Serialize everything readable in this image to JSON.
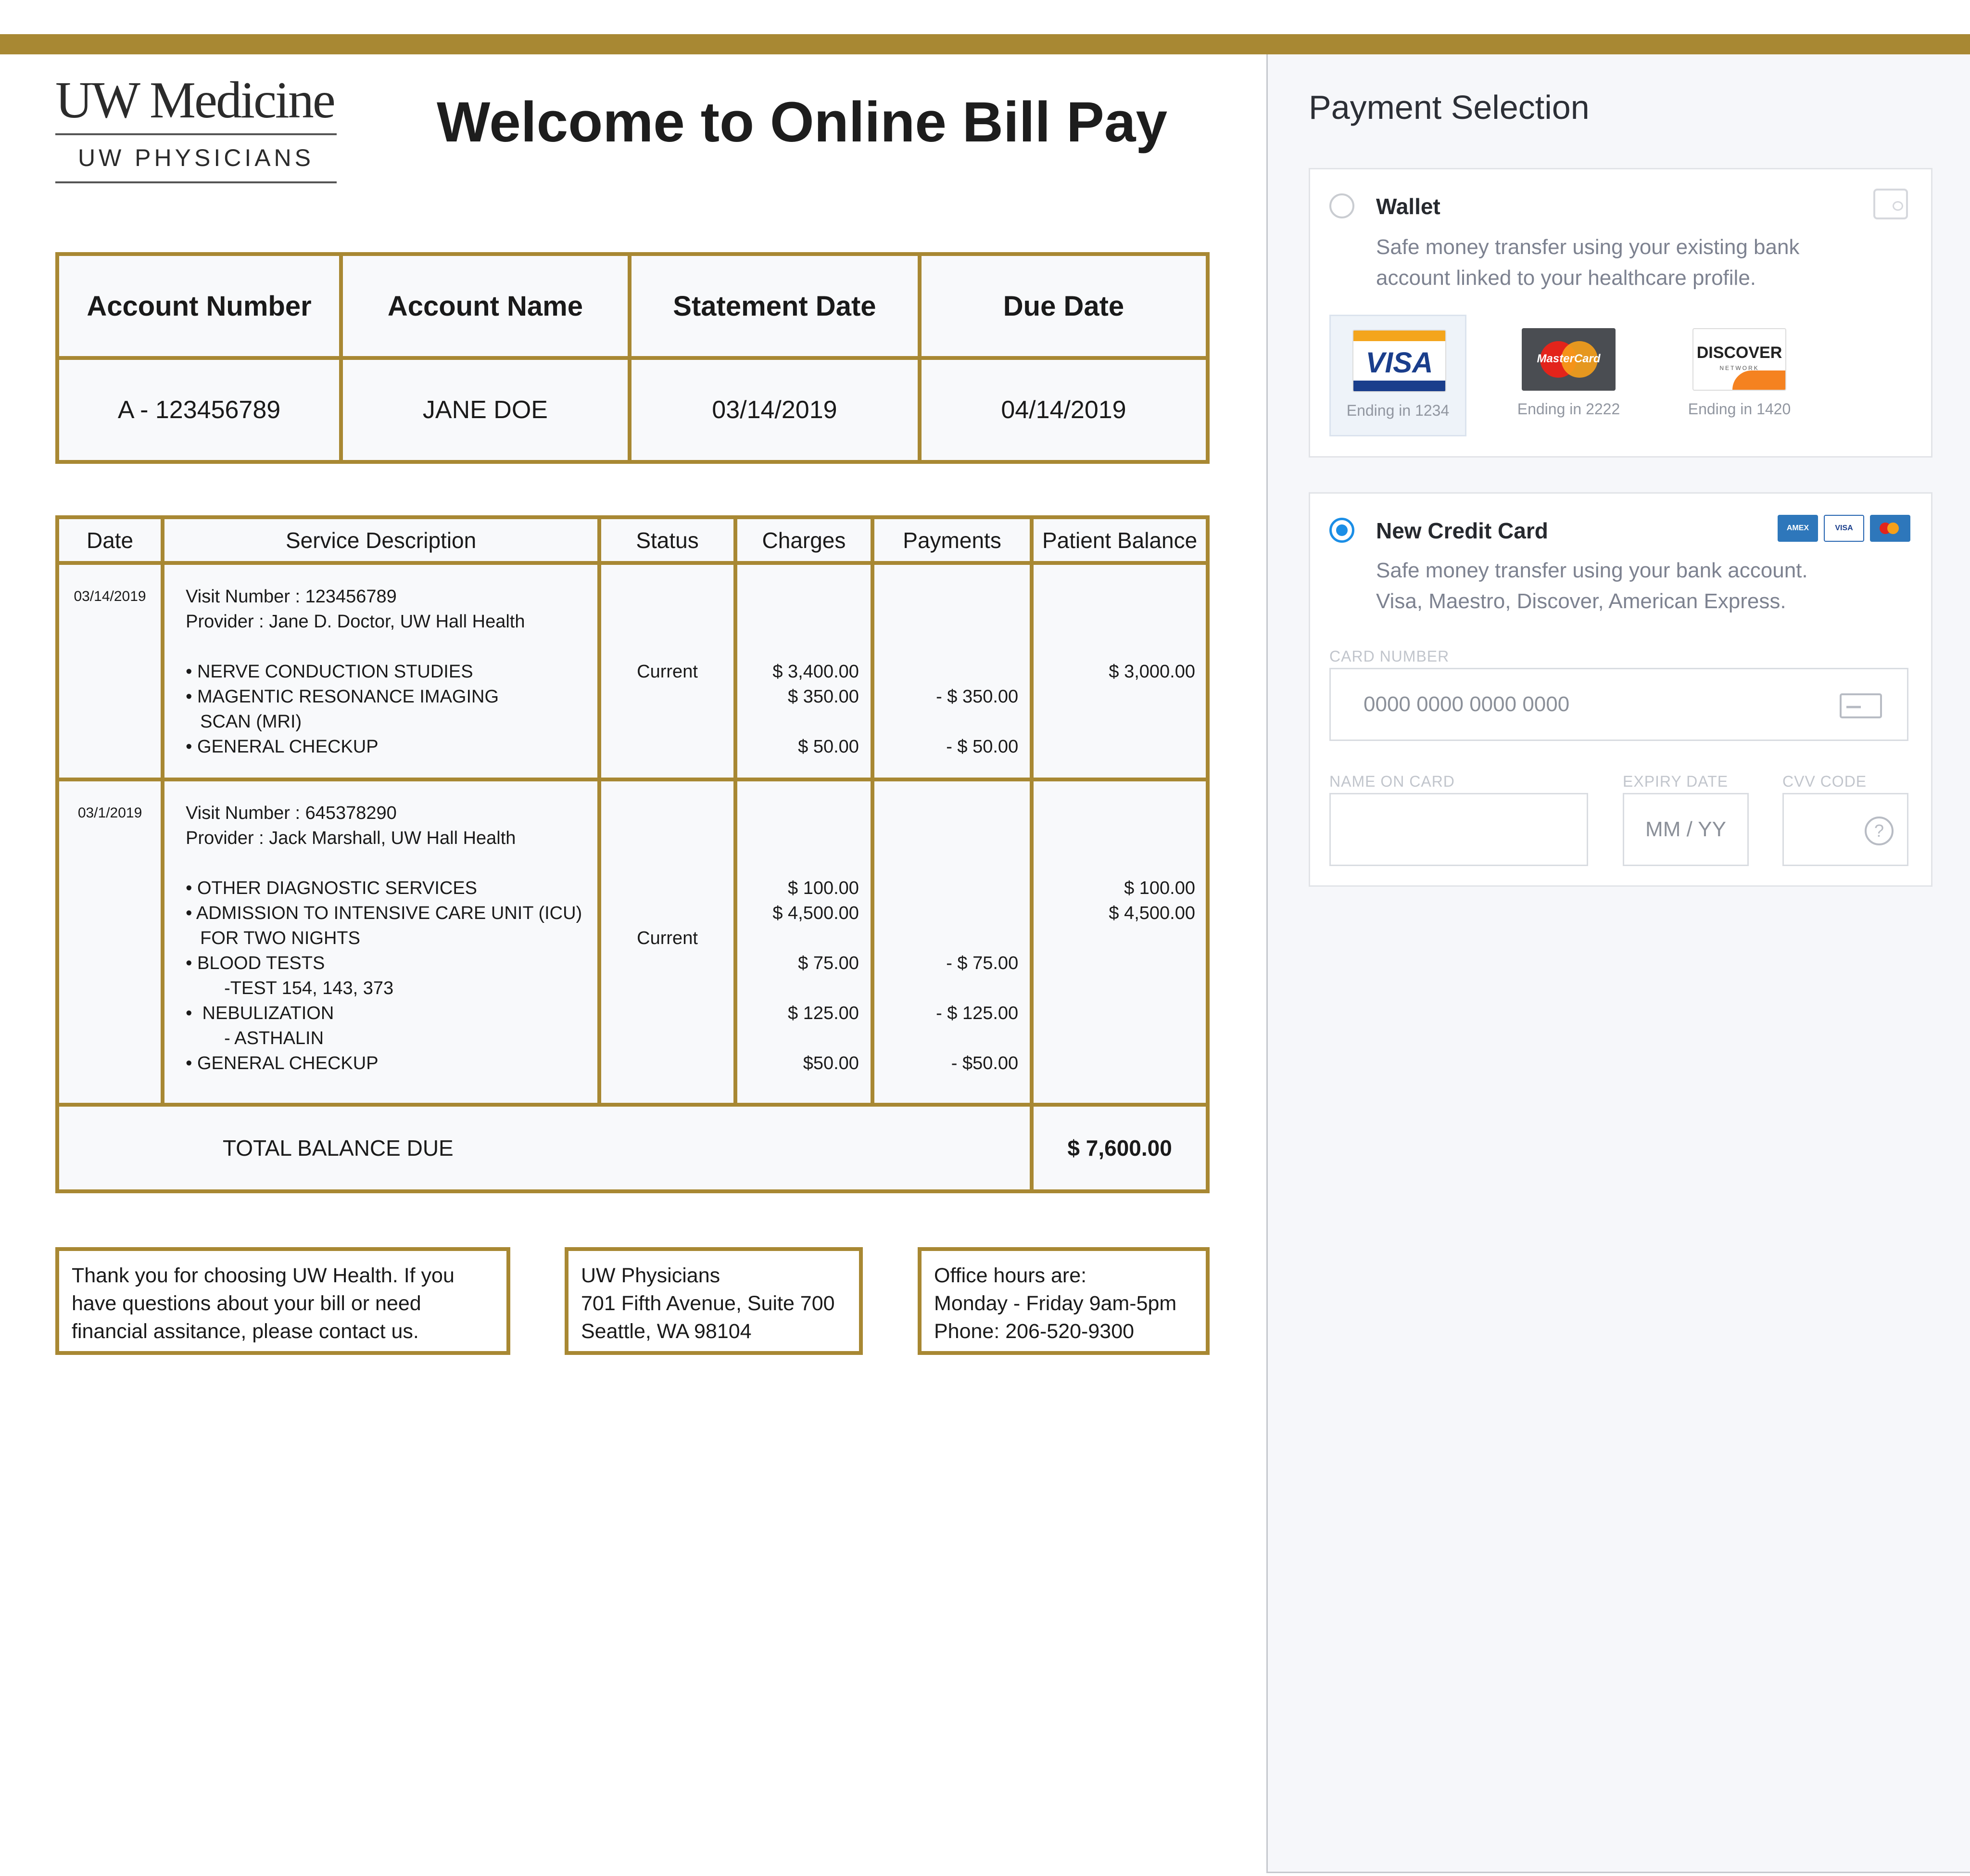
{
  "logo": {
    "main": "UW Medicine",
    "sub": "UW PHYSICIANS"
  },
  "page_title": "Welcome to Online Bill Pay",
  "account": {
    "headers": [
      "Account Number",
      "Account Name",
      "Statement Date",
      "Due Date"
    ],
    "values": [
      "A - 123456789",
      "JANE DOE",
      "03/14/2019",
      "04/14/2019"
    ]
  },
  "services": {
    "headers": [
      "Date",
      "Service Description",
      "Status",
      "Charges",
      "Payments",
      "Patient Balance"
    ],
    "visits": [
      {
        "date": "03/14/2019",
        "visit_number": "Visit Number : 123456789",
        "provider": "Provider : Jane D. Doctor, UW Hall Health",
        "status": "Current",
        "items": [
          "• NERVE CONDUCTION STUDIES",
          "• MAGENTIC RESONANCE IMAGING",
          "SCAN (MRI)",
          "• GENERAL CHECKUP"
        ],
        "charges": [
          "$ 3,400.00",
          "$ 350.00",
          "",
          "$ 50.00"
        ],
        "payments": [
          "",
          "- $ 350.00",
          "",
          "- $ 50.00"
        ],
        "balance": [
          "$ 3,000.00"
        ]
      },
      {
        "date": "03/1/2019",
        "visit_number": "Visit Number : 645378290",
        "provider": "Provider : Jack Marshall, UW Hall Health",
        "status": "Current",
        "items": [
          "• OTHER DIAGNOSTIC SERVICES",
          "• ADMISSION TO INTENSIVE CARE UNIT (ICU)",
          "FOR TWO NIGHTS",
          "• BLOOD TESTS",
          "-TEST 154, 143, 373",
          "•  NEBULIZATION",
          "- ASTHALIN",
          "• GENERAL CHECKUP"
        ],
        "charges": [
          "$ 100.00",
          "$ 4,500.00",
          "",
          "$ 75.00",
          "",
          "$ 125.00",
          "",
          "$50.00"
        ],
        "payments": [
          "",
          "",
          "",
          "- $ 75.00",
          "",
          "- $ 125.00",
          "",
          "- $50.00"
        ],
        "balance": [
          "$ 100.00",
          "$ 4,500.00"
        ]
      }
    ],
    "total_label": "TOTAL  BALANCE DUE",
    "total_amount": "$ 7,600.00"
  },
  "info": {
    "thanks": [
      "Thank you for choosing UW Health. If you",
      "have questions about your bill or need",
      "financial assitance, please contact us."
    ],
    "address": [
      "UW Physicians",
      "701 Fifth Avenue, Suite 700",
      "Seattle, WA 98104"
    ],
    "hours": [
      "Office hours are:",
      "Monday - Friday 9am-5pm",
      "Phone: 206-520-9300"
    ]
  },
  "payment": {
    "title": "Payment Selection",
    "wallet": {
      "title": "Wallet",
      "desc": [
        "Safe money transfer using your existing bank",
        "account linked to your healthcare profile."
      ],
      "cards": [
        {
          "brand": "VISA",
          "ending": "Ending in 1234"
        },
        {
          "brand": "MasterCard",
          "ending": "Ending in 2222"
        },
        {
          "brand": "DISCOVER",
          "brand_sub": "NETWORK",
          "ending": "Ending in 1420"
        }
      ]
    },
    "new_card": {
      "title": "New Credit Card",
      "desc": [
        "Safe money transfer using your bank account.",
        "Visa, Maestro, Discover, American Express."
      ],
      "mini_brands": [
        "AMEX",
        "VISA"
      ],
      "card_number_label": "CARD NUMBER",
      "card_number_placeholder": "0000 0000 0000 0000",
      "name_label": "NAME ON CARD",
      "expiry_label": "EXPIRY DATE",
      "expiry_placeholder": "MM / YY",
      "cvv_label": "CVV CODE",
      "help_glyph": "?"
    }
  }
}
